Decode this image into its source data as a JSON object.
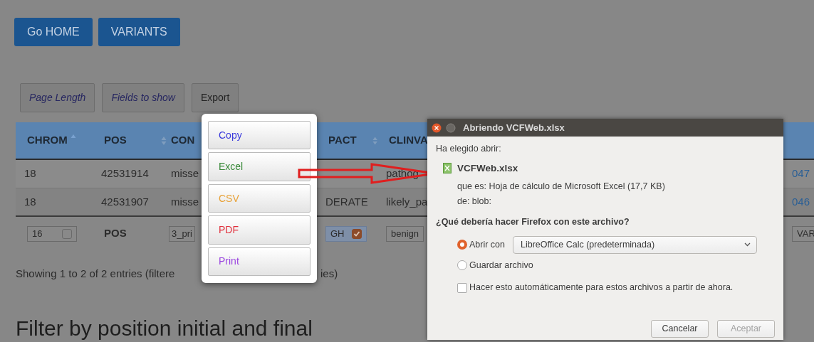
{
  "nav_buttons": [
    "Go HOME",
    "VARIANTS"
  ],
  "toolbar": [
    {
      "label": "Page Length",
      "kind": "italic"
    },
    {
      "label": "Fields to show",
      "kind": "italic"
    },
    {
      "label": "Export",
      "kind": "plain"
    }
  ],
  "table": {
    "columns": [
      {
        "label": "CHROM",
        "sorted": true
      },
      {
        "label": "POS",
        "sorted": false
      },
      {
        "label": "CON"
      },
      {
        "label": "PACT",
        "sorted": false
      },
      {
        "label": "CLINVA"
      }
    ],
    "rows": [
      [
        "18",
        "42531914",
        "misse",
        null,
        "pathog",
        "047"
      ],
      [
        "18",
        "42531907",
        "misse",
        "DERATE",
        "likely_pa",
        "046"
      ]
    ],
    "filters": [
      {
        "kind": "input",
        "value": "16",
        "checked": false
      },
      {
        "kind": "label",
        "text": "POS"
      },
      {
        "kind": "input",
        "value": "3_pri"
      },
      {
        "kind": "input",
        "value": "GH",
        "checked": true,
        "selected": true
      },
      {
        "kind": "input",
        "value": "benign"
      },
      {
        "kind": "input",
        "value": "VAR"
      }
    ]
  },
  "info": [
    "Showing 1 to 2 of 2 entries (filtere",
    "ies)"
  ],
  "heading": "Filter by position initial and final",
  "export_menu": [
    {
      "label": "Copy",
      "color": "#3b3bdc"
    },
    {
      "label": "Excel",
      "color": "#3a8a3a"
    },
    {
      "label": "CSV",
      "color": "#e8a33a"
    },
    {
      "label": "PDF",
      "color": "#e0303c"
    },
    {
      "label": "Print",
      "color": "#9a45e0"
    }
  ],
  "dialog": {
    "title": "Abriendo VCFWeb.xlsx",
    "intro": "Ha elegido abrir:",
    "file_name": "VCFWeb.xlsx",
    "file_type": "que es: Hoja de cálculo de Microsoft Excel (17,7 KB)",
    "source": "de: blob:",
    "question": "¿Qué debería hacer Firefox con este archivo?",
    "options": [
      {
        "label": "Abrir con",
        "selected": true
      },
      {
        "label": "Guardar archivo",
        "selected": false
      }
    ],
    "app_select": "LibreOffice Calc (predeterminada)",
    "remember": {
      "label": "Hacer esto automáticamente para estos archivos a partir de ahora.",
      "checked": false
    },
    "buttons": [
      {
        "label": "Cancelar",
        "disabled": false
      },
      {
        "label": "Aceptar",
        "disabled": true
      }
    ]
  }
}
